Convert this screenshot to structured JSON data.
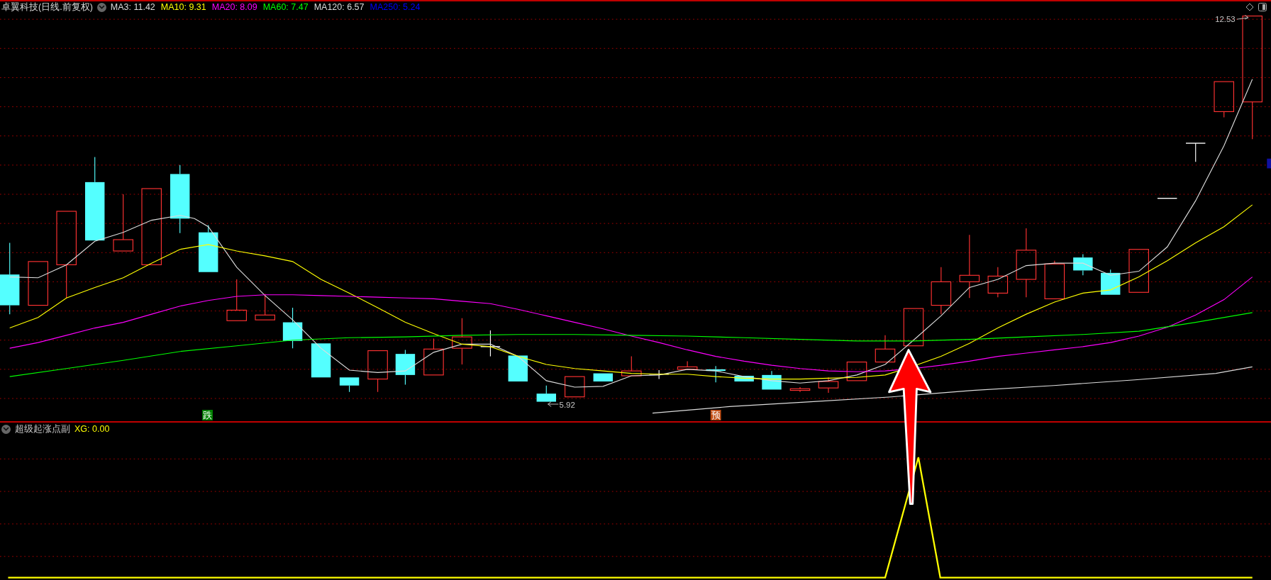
{
  "header": {
    "title": "卓翼科技(日线.前复权)",
    "indicators": [
      {
        "label": "MA3: 11.42",
        "color": "#dcdcdc"
      },
      {
        "label": "MA10: 9.31",
        "color": "#ffff00"
      },
      {
        "label": "MA20: 8.09",
        "color": "#ff00ff"
      },
      {
        "label": "MA60: 7.47",
        "color": "#00ff00"
      },
      {
        "label": "MA120: 6.57",
        "color": "#dcdcdc"
      },
      {
        "label": "MA250: 5.24",
        "color": "#0000ff"
      }
    ]
  },
  "price_chart": {
    "high_label": "12.53",
    "low_label": "5.92",
    "signals": [
      {
        "text": "跌",
        "color": "#008000"
      },
      {
        "text": "预",
        "color": "#c04a10"
      }
    ]
  },
  "sub_panel": {
    "title": "超级起涨点副",
    "indicators": [
      {
        "label": "XG: 0.00",
        "color": "#ffff00"
      }
    ]
  }
}
